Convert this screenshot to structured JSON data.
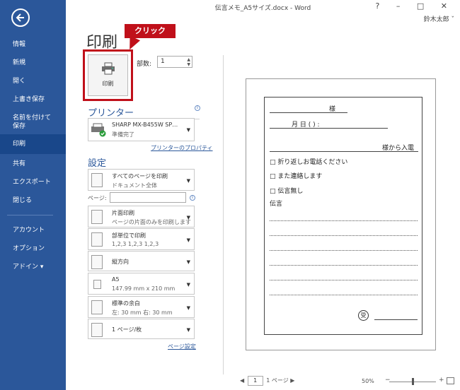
{
  "window": {
    "title": "伝言メモ_A5サイズ.docx - Word",
    "controls": "? – □ ✕",
    "user": "鈴木太郎 ˇ"
  },
  "sidebar": {
    "items": [
      {
        "label": "情報"
      },
      {
        "label": "新規"
      },
      {
        "label": "開く"
      },
      {
        "label": "上書き保存"
      },
      {
        "label": "名前を付けて\n保存"
      },
      {
        "label": "印刷"
      },
      {
        "label": "共有"
      },
      {
        "label": "エクスポート"
      },
      {
        "label": "閉じる"
      },
      {
        "label": "アカウント"
      },
      {
        "label": "オプション"
      },
      {
        "label": "アドイン ▾"
      }
    ],
    "active": "印刷",
    "colors": {
      "background": "#2b579a",
      "active": "#19478a"
    }
  },
  "main": {
    "heading": "印刷",
    "callout": "クリック",
    "callout_color": "#c0101a",
    "print_button": "印刷",
    "copies_label": "部数:",
    "copies_value": "1",
    "printer_heading": "プリンター",
    "printer_name": "SHARP MX-B455W SP…",
    "printer_status": "準備完了",
    "printer_properties": "プリンターのプロパティ",
    "settings_heading": "設定",
    "settings": [
      {
        "line1": "すべてのページを印刷",
        "line2": "ドキュメント全体"
      },
      {
        "line1": "片面印刷",
        "line2": "ページの片面のみを印刷します"
      },
      {
        "line1": "部単位で印刷",
        "line2": "1,2,3    1,2,3    1,2,3"
      },
      {
        "line1": "縦方向",
        "line2": ""
      },
      {
        "line1": "A5",
        "line2": "147.99 mm x 210 mm"
      },
      {
        "line1": "標準の余白",
        "line2": "左:  30 mm    右:  30 mm"
      },
      {
        "line1": "1 ページ/枚",
        "line2": ""
      }
    ],
    "pages_label": "ページ:",
    "page_setup_link": "ページ設定"
  },
  "preview": {
    "memo": {
      "addressee": "様",
      "date_line": "月      日 (   )      :",
      "caller": "様から入電",
      "options": [
        "□   折り返しお電話ください",
        "□   また連絡します",
        "□   伝言無し"
      ],
      "message_label": "伝言",
      "stamp": "受"
    },
    "pager": {
      "current": "1",
      "total": "1 ページ"
    },
    "zoom": "50%"
  }
}
